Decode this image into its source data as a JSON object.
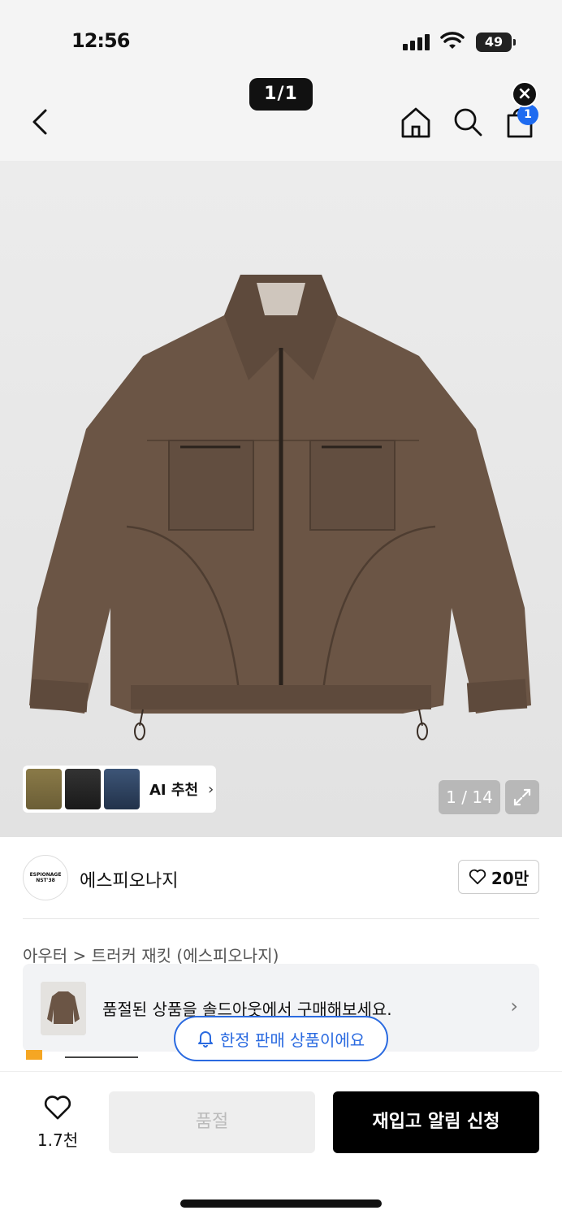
{
  "status_bar": {
    "time": "12:56",
    "battery": "49"
  },
  "header": {
    "page_indicator": "1/1",
    "cart_count": "1"
  },
  "gallery": {
    "ai_recommend_label": "AI 추천",
    "image_counter": "1 / 14"
  },
  "brand": {
    "name": "에스피오나지",
    "logo_text": "ESPIONAGE",
    "logo_subtext": "NST'38",
    "likes": "20만"
  },
  "breadcrumb": {
    "text": "아우터 > 트러커 재킷 (에스피오나지)"
  },
  "soldout_banner": {
    "text": "품절된 상품을 솔드아웃에서 구매해보세요."
  },
  "limited_pill": {
    "text": "한정 판매 상품이에요"
  },
  "bottom_bar": {
    "wish_count": "1.7천",
    "soldout_label": "품절",
    "restock_label": "재입고 알림 신청"
  },
  "colors": {
    "accent_blue": "#2a6ae0",
    "black": "#000000",
    "jacket_brown": "#6b5545"
  }
}
